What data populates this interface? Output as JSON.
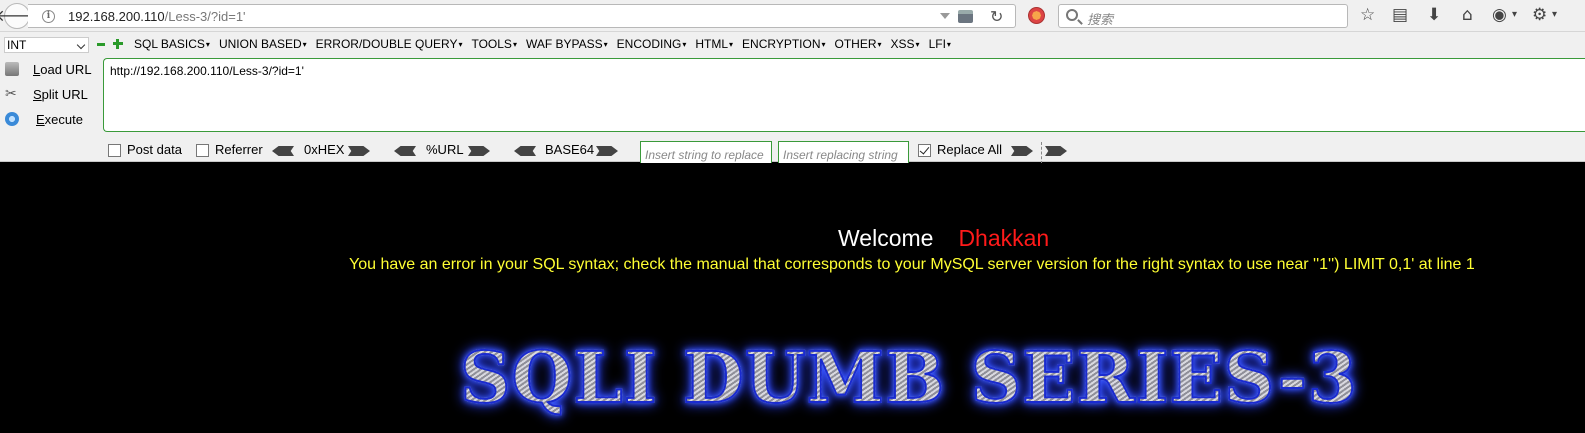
{
  "browser": {
    "url_host": "192.168.200.110",
    "url_path": "/Less-3/?id=1'",
    "search_placeholder": "搜索"
  },
  "hackbar": {
    "type_select": "INT",
    "menu": [
      "SQL BASICS",
      "UNION BASED",
      "ERROR/DOUBLE QUERY",
      "TOOLS",
      "WAF BYPASS",
      "ENCODING",
      "HTML",
      "ENCRYPTION",
      "OTHER",
      "XSS",
      "LFI"
    ],
    "actions": {
      "load": "Load URL",
      "split": "Split URL",
      "execute": "Execute"
    },
    "url_value": "http://192.168.200.110/Less-3/?id=1'",
    "options": {
      "post_data": "Post data",
      "referrer": "Referrer",
      "hex": "0xHEX",
      "url": "%URL",
      "base64": "BASE64",
      "replace_from_placeholder": "Insert string to replace",
      "replace_to_placeholder": "Insert replacing string",
      "replace_all": "Replace All"
    }
  },
  "page": {
    "welcome": "Welcome",
    "name": "Dhakkan",
    "error": "You have an error in your SQL syntax; check the manual that corresponds to your MySQL server version for the right syntax to use near ''1'') LIMIT 0,1' at line 1",
    "title": "SQLI DUMB SERIES-3"
  },
  "colors": {
    "welcome": "#ffffff",
    "name": "#ff1a1a",
    "error": "#ffff33",
    "hackbar_border": "#3a9a3a"
  }
}
